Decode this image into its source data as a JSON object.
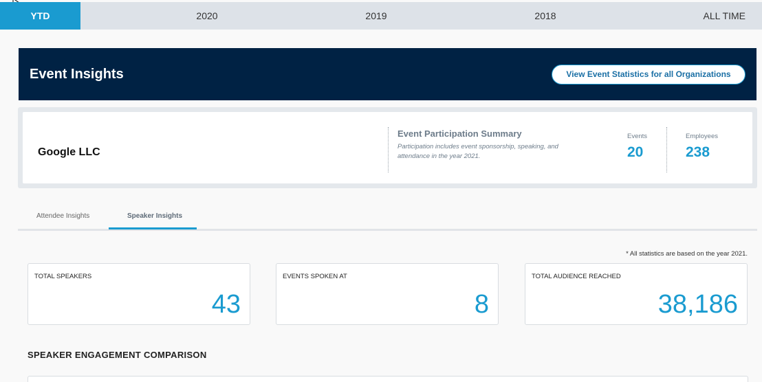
{
  "year_tabs": [
    {
      "label": "YTD",
      "active": true
    },
    {
      "label": "2020",
      "active": false
    },
    {
      "label": "2019",
      "active": false
    },
    {
      "label": "2018",
      "active": false
    },
    {
      "label": "ALL TIME",
      "active": false
    }
  ],
  "banner": {
    "title": "Event Insights",
    "button_label": "View Event Statistics for all Organizations"
  },
  "org": {
    "name": "Google LLC",
    "summary_title": "Event Participation Summary",
    "summary_desc": "Participation includes event sponsorship, speaking, and attendance in the year 2021.",
    "events_label": "Events",
    "events_value": "20",
    "employees_label": "Employees",
    "employees_value": "238"
  },
  "insight_tabs": [
    {
      "label": "Attendee Insights",
      "active": false
    },
    {
      "label": "Speaker Insights",
      "active": true
    }
  ],
  "note": "* All statistics are based on the year 2021.",
  "stats": [
    {
      "label": "TOTAL SPEAKERS",
      "value": "43"
    },
    {
      "label": "EVENTS SPOKEN AT",
      "value": "8"
    },
    {
      "label": "TOTAL AUDIENCE REACHED",
      "value": "38,186"
    }
  ],
  "section_title": "SPEAKER ENGAGEMENT COMPARISON",
  "colors": {
    "accent": "#1a9bd0",
    "banner_bg": "#002244",
    "tab_bar_bg": "#dde2e8"
  }
}
